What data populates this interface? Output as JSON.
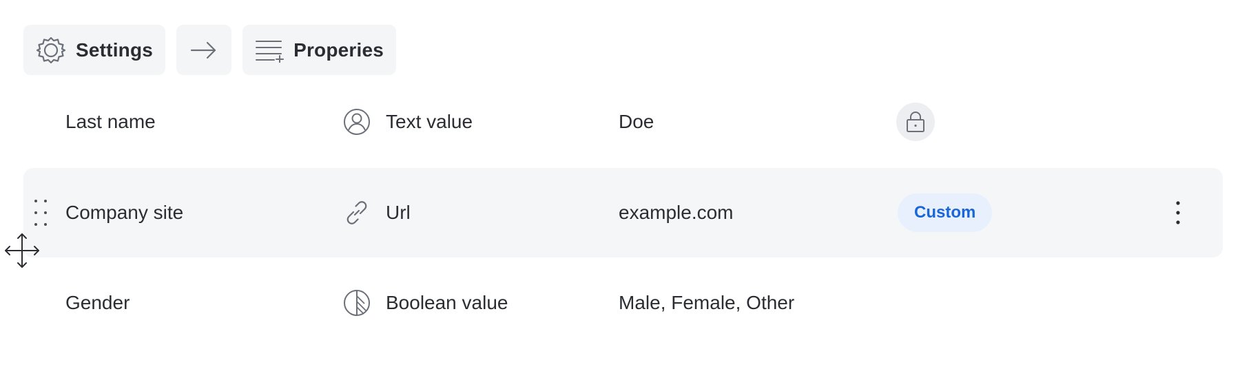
{
  "breadcrumb": {
    "settings_label": "Settings",
    "arrow_icon": "arrow-right-icon",
    "properties_label": "Properies"
  },
  "rows": [
    {
      "name": "Last name",
      "type_icon": "user-circle-icon",
      "type": "Text value",
      "value": "Doe",
      "badge_icon": "lock-icon"
    },
    {
      "name": "Company site",
      "type_icon": "link-icon",
      "type": "Url",
      "value": "example.com",
      "tag": "Custom",
      "hovered": true
    },
    {
      "name": "Gender",
      "type_icon": "boolean-icon",
      "type": "Boolean value",
      "value": "Male, Female, Other"
    }
  ],
  "colors": {
    "chip_bg": "#f4f5f7",
    "row_hover_bg": "#f5f6f8",
    "tag_bg": "#e8f0fe",
    "tag_text": "#1a66d9",
    "text": "#2b2d33",
    "icon": "#6b6f78"
  }
}
